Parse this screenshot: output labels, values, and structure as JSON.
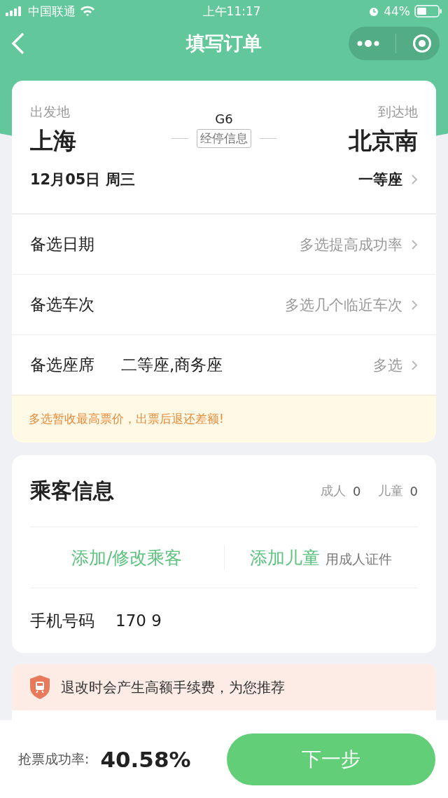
{
  "status_bar": {
    "carrier": "中国联通",
    "time": "上午11:17",
    "battery": "44%"
  },
  "nav": {
    "title": "填写订单"
  },
  "trip": {
    "from_label": "出发地",
    "from": "上海",
    "train": "G6",
    "stops": "经停信息",
    "to_label": "到达地",
    "to": "北京南",
    "date": "12月05日 周三",
    "seat": "一等座"
  },
  "options": [
    {
      "label": "备选日期",
      "hint": "多选提高成功率"
    },
    {
      "label": "备选车次",
      "hint": "多选几个临近车次"
    },
    {
      "label": "备选座席",
      "value": "二等座,商务座",
      "hint": "多选"
    }
  ],
  "notice": "多选暂收最高票价，出票后退还差额!",
  "passengers": {
    "title": "乘客信息",
    "adult_label": "成人",
    "adult": "0",
    "child_label": "儿童",
    "child": "0",
    "add_passenger": "添加/修改乘客",
    "add_child": "添加儿童",
    "add_child_note": "用成人证件",
    "phone_label": "手机号码",
    "phone": "170 9"
  },
  "warning": "退改时会产生高额手续费，为您推荐",
  "footer": {
    "rate_label": "抢票成功率:",
    "rate": "40.58%",
    "next": "下一步"
  }
}
